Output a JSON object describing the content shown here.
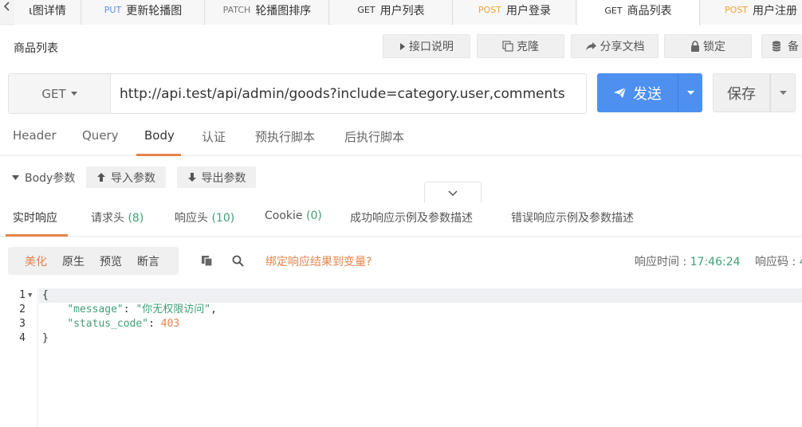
{
  "tabs": [
    {
      "method": "",
      "label": "ι图详情"
    },
    {
      "method": "PUT",
      "label": "更新轮播图"
    },
    {
      "method": "PATCH",
      "label": "轮播图排序"
    },
    {
      "method": "GET",
      "label": "用户列表"
    },
    {
      "method": "POST",
      "label": "用户登录"
    },
    {
      "method": "GET",
      "label": "商品列表"
    },
    {
      "method": "POST",
      "label": "用户注册"
    }
  ],
  "page_title": "商品列表",
  "toolbar": {
    "doc": "接口说明",
    "clone": "克隆",
    "share": "分享文档",
    "lock": "锁定",
    "backup": "备"
  },
  "request": {
    "method": "GET",
    "url": "http://api.test/api/admin/goods?include=category.user,comments",
    "send_label": "发送",
    "save_label": "保存"
  },
  "request_tabs": [
    "Header",
    "Query",
    "Body",
    "认证",
    "预执行脚本",
    "后执行脚本"
  ],
  "active_request_tab": "Body",
  "body_params": {
    "label": "Body参数",
    "import": "导入参数",
    "export": "导出参数"
  },
  "response_tabs": [
    {
      "label": "实时响应",
      "count": ""
    },
    {
      "label": "请求头",
      "count": "(8)"
    },
    {
      "label": "响应头",
      "count": "(10)"
    },
    {
      "label": "Cookie",
      "count": "(0)"
    },
    {
      "label": "成功响应示例及参数描述",
      "count": ""
    },
    {
      "label": "错误响应示例及参数描述",
      "count": ""
    }
  ],
  "view_modes": [
    "美化",
    "原生",
    "预览",
    "断言"
  ],
  "active_view_mode": "美化",
  "bind_link": "绑定响应结果到变量?",
  "response_meta": {
    "time_label": "响应时间 : ",
    "time_value": "17:46:24",
    "code_label": "响应码 : ",
    "code_value": "4"
  },
  "response_body": {
    "lines": [
      "1",
      "2",
      "3",
      "4"
    ],
    "open_brace": "{",
    "message_key": "\"message\"",
    "message_value": "\"你无权限访问\"",
    "status_key": "\"status_code\"",
    "status_value": "403",
    "close_brace": "}"
  },
  "colors": {
    "accent": "#e4834b",
    "primary": "#4d90f0",
    "success": "#3f9f76",
    "post": "#f2a332",
    "put": "#5a8fe8"
  }
}
